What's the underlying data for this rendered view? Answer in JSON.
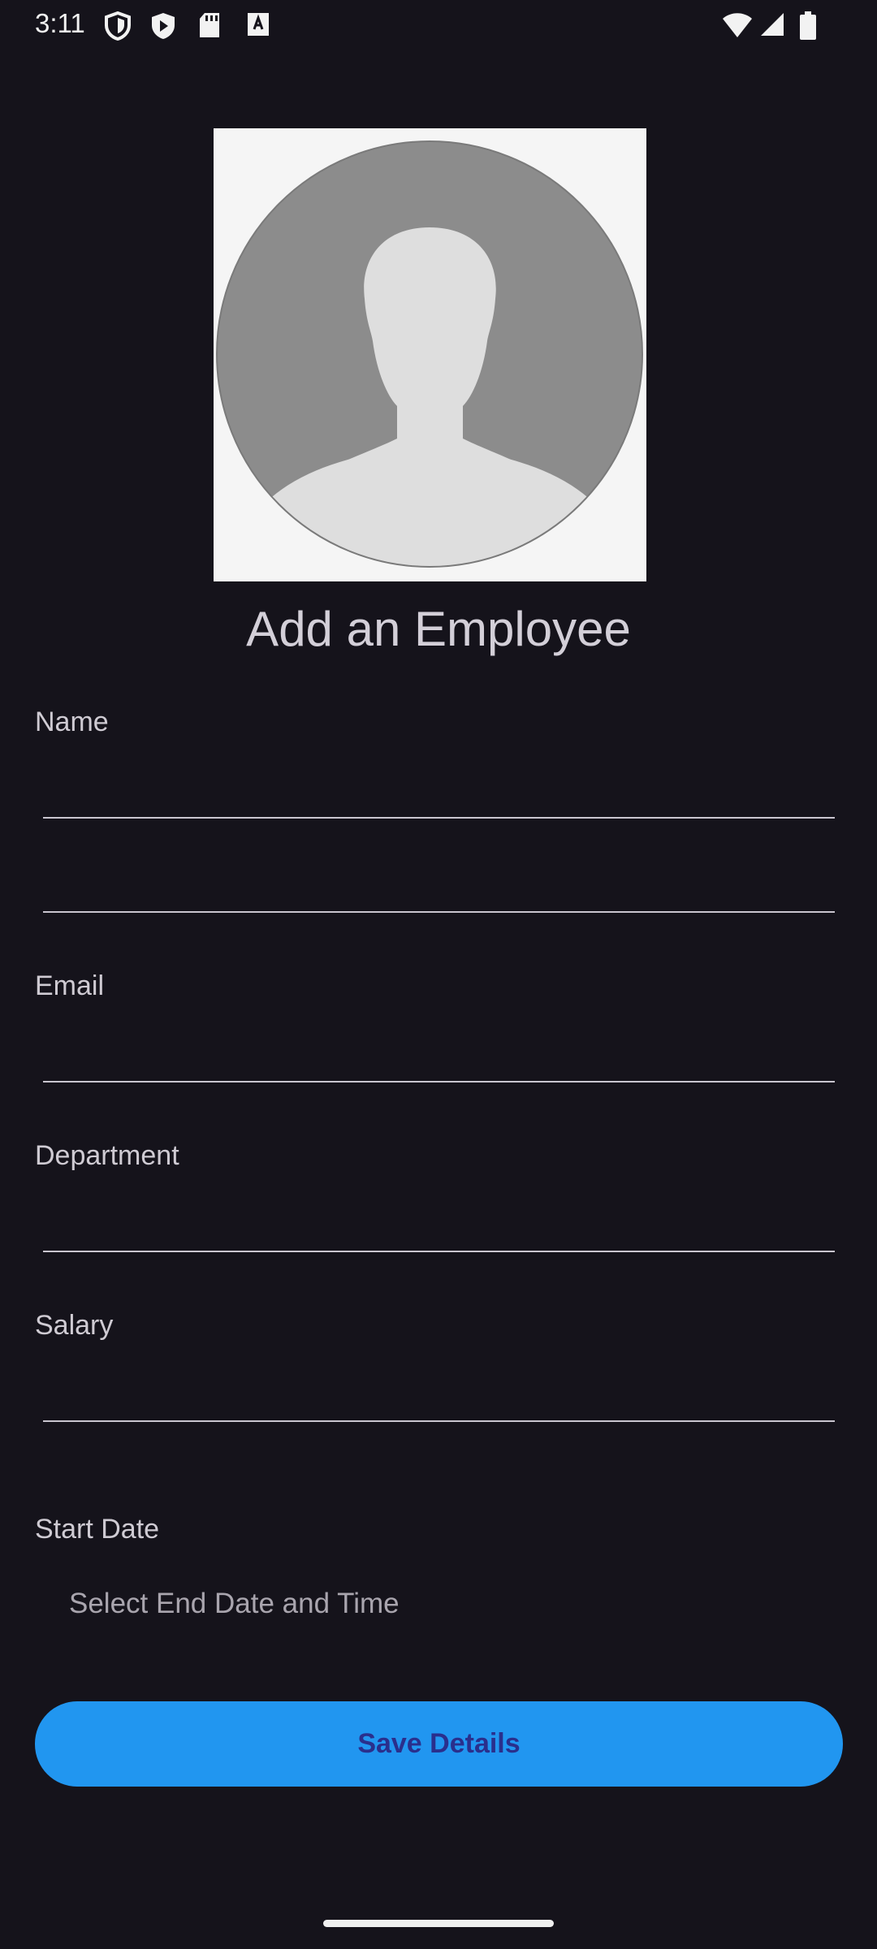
{
  "status_bar": {
    "time": "3:11",
    "left_icons": [
      "shield-icon",
      "play-protect-icon",
      "sd-card-icon",
      "font-a-icon"
    ],
    "right_icons": [
      "wifi-icon",
      "signal-icon",
      "battery-icon"
    ]
  },
  "profile": {
    "avatar_icon": "person-silhouette-icon"
  },
  "title": "Add an Employee",
  "form": {
    "name_label": "Name",
    "name_value": "",
    "name_secondary_value": "",
    "email_label": "Email",
    "email_value": "",
    "department_label": "Department",
    "department_value": "",
    "salary_label": "Salary",
    "salary_value": "",
    "start_date_label": "Start Date",
    "date_picker_text": "Select End Date and Time"
  },
  "save_button_label": "Save Details",
  "colors": {
    "background": "#15131b",
    "accent": "#2196f0",
    "button_text": "#2a2f8c"
  }
}
